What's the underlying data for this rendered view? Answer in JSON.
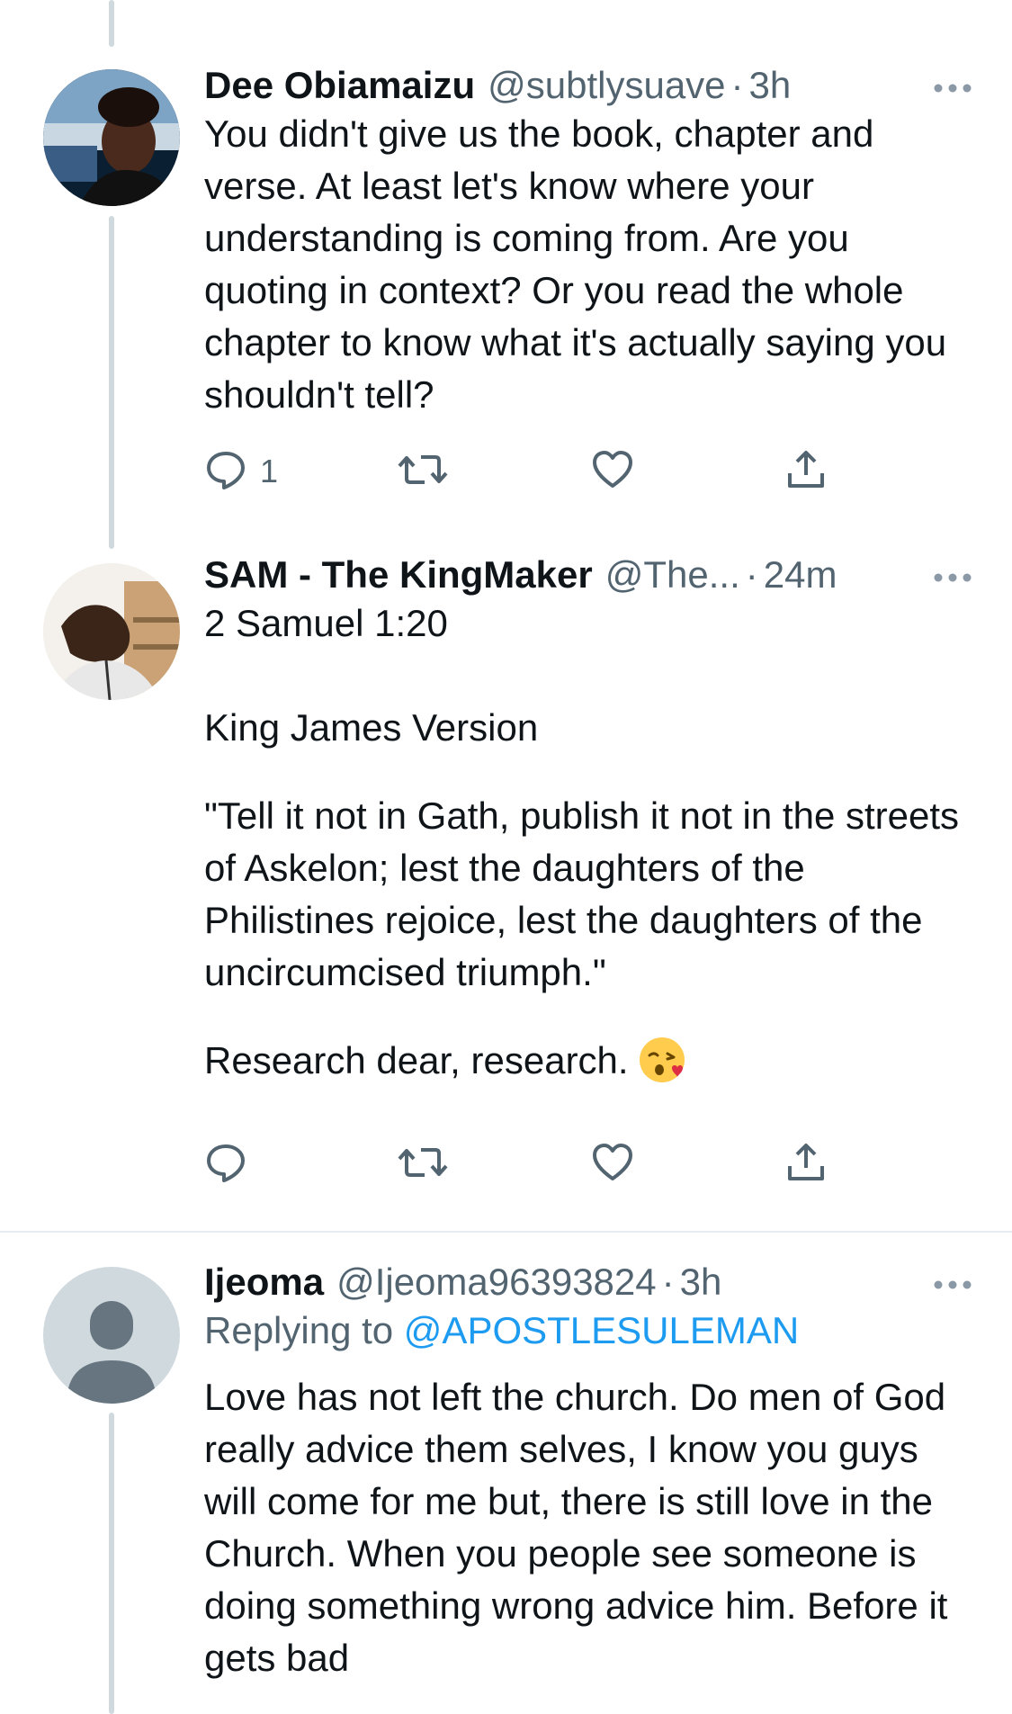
{
  "tweets": [
    {
      "name": "Dee Obiamaizu",
      "handle": "@subtlysuave",
      "separator": "·",
      "time": "3h",
      "text": "You didn't give us the book, chapter and verse. At least let's know where your understanding is coming from. Are you quoting in context? Or you read the whole chapter to know what it's actually saying you shouldn't tell?",
      "reply_count": "1",
      "icons": {
        "reply": "reply-icon",
        "retweet": "retweet-icon",
        "like": "heart-icon",
        "share": "share-icon",
        "more": "more-icon"
      }
    },
    {
      "name": "SAM - The KingMaker",
      "handle": "@The...",
      "separator": "·",
      "time": "24m",
      "text_lines": [
        "2 Samuel 1:20",
        "King James Version",
        "\"Tell it not in Gath, publish it not in the streets of Askelon; lest the daughters of the Philistines rejoice, lest the daughters of the uncircumcised triumph.\"",
        "Research dear, research."
      ],
      "emoji": "face-blowing-kiss",
      "reply_count": ""
    },
    {
      "name": "Ijeoma",
      "handle": "@Ijeoma96393824",
      "separator": "·",
      "time": "3h",
      "replying_prefix": "Replying to",
      "replying_to": "@APOSTLESULEMAN",
      "text": "Love has not left the church. Do men of God really advice them selves, I know you guys will come for me but, there is still love in the Church. When you people see someone is doing something wrong advice him. Before it gets bad"
    }
  ],
  "colors": {
    "primary_text": "#0f1419",
    "secondary_text": "#536471",
    "link": "#1d9bf0",
    "thread_line": "#cfd9de",
    "divider": "#e6ecf0"
  }
}
